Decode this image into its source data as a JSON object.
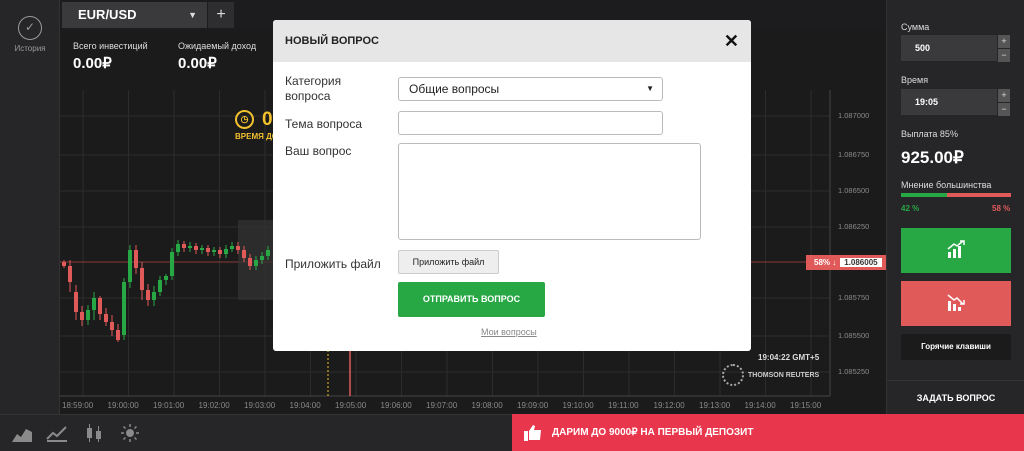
{
  "sidebar": {
    "history_label": "История"
  },
  "tabs": {
    "asset": "EUR/USD",
    "add": "+"
  },
  "stats": {
    "invested_label": "Всего инвестиций",
    "invested_value": "0.00₽",
    "expected_label": "Ожидаемый доход",
    "expected_value": "0.00₽"
  },
  "clock": {
    "digit": "0",
    "label": "ВРЕМЯ ДО"
  },
  "chart": {
    "price_ticks": [
      "1.087000",
      "1.086750",
      "1.086500",
      "1.086250",
      "1.085750",
      "1.085500",
      "1.085250"
    ],
    "time_ticks": [
      "18:59:00",
      "19:00:00",
      "19:01:00",
      "19:02:00",
      "19:03:00",
      "19:04:00",
      "19:05:00",
      "19:06:00",
      "19:07:00",
      "19:08:00",
      "19:09:00",
      "19:10:00",
      "19:11:00",
      "19:12:00",
      "19:13:00",
      "19:14:00",
      "19:15:00"
    ],
    "current_tag": "58% ↓",
    "current_price": "1.086005",
    "live_time": "19:04:22 GMT+5",
    "provider": "THOMSON REUTERS"
  },
  "right_panel": {
    "amount_label": "Сумма",
    "amount_value": "500",
    "time_label": "Время",
    "time_value": "19:05",
    "payout_label": "Выплата 85%",
    "payout_value": "925.00₽",
    "majority_label": "Мнение большинства",
    "up_pct": "42 %",
    "down_pct": "58 %",
    "up_fraction": 0.42,
    "hotkeys_label": "Горячие клавиши",
    "ask_label": "ЗАДАТЬ ВОПРОС",
    "stepper_plus": "+",
    "stepper_minus": "−"
  },
  "promo": {
    "text": "ДАРИМ ДО 9000₽ НА ПЕРВЫЙ ДЕПОЗИТ"
  },
  "modal": {
    "title": "НОВЫЙ ВОПРОС",
    "close": "✕",
    "category_label": "Категория вопроса",
    "category_value": "Общие вопросы",
    "topic_label": "Тема вопроса",
    "question_label": "Ваш вопрос",
    "attach_label": "Приложить файл",
    "attach_button": "Приложить файл",
    "send_button": "ОТПРАВИТЬ ВОПРОС",
    "my_questions": "Мои вопросы"
  },
  "colors": {
    "up": "#28a745",
    "down": "#e05a5a",
    "promo": "#e8374d",
    "accent_yellow": "#f2c12e"
  }
}
